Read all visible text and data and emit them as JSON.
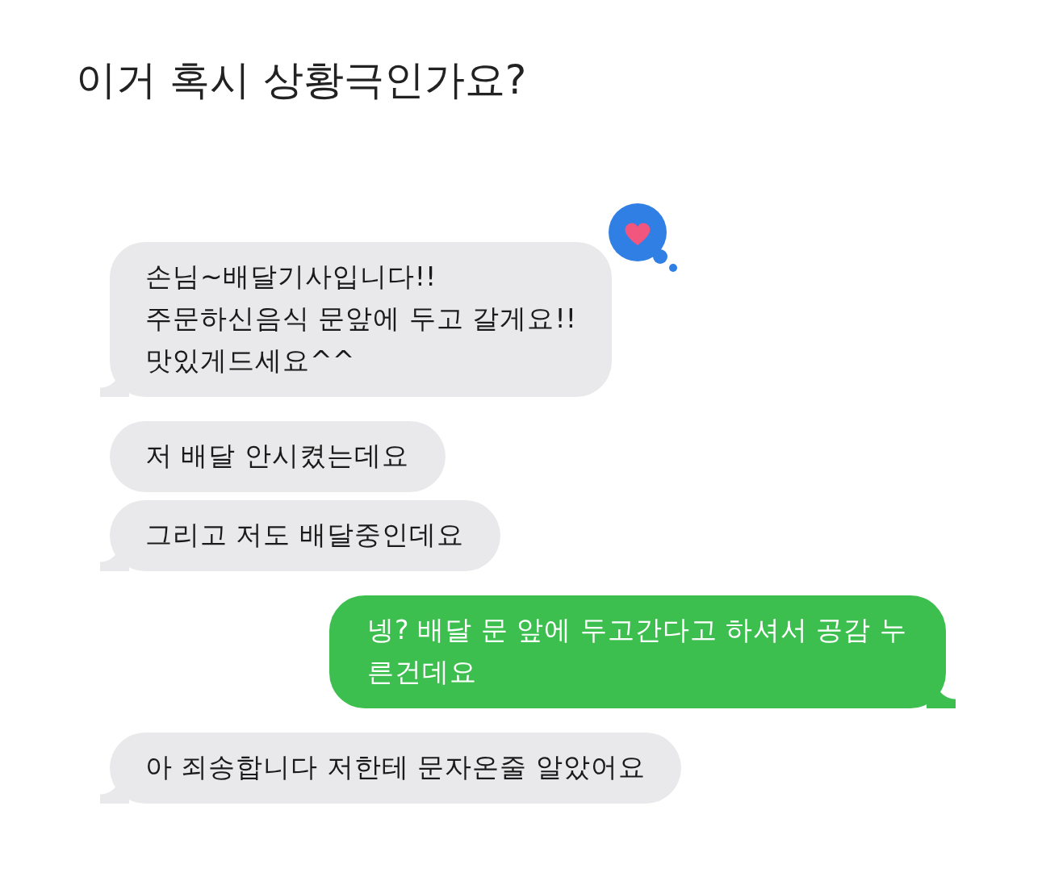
{
  "title": "이거 혹시 상황극인가요?",
  "messages": [
    {
      "kind": "received",
      "text": "손님~배달기사입니다!!\n주문하신음식 문앞에 두고 갈게요!!\n맛있게드세요^^",
      "tail": true,
      "hearted": true
    },
    {
      "kind": "received",
      "text": "저 배달 안시켰는데요",
      "tail": false
    },
    {
      "kind": "received",
      "text": "그리고 저도 배달중인데요",
      "tail": true
    },
    {
      "kind": "sent",
      "text": "넹? 배달 문 앞에 두고간다고 하셔서 공감 누\n른건데요",
      "tail": true
    },
    {
      "kind": "received",
      "text": "아 죄송합니다 저한테 문자온줄 알았어요",
      "tail": true
    }
  ]
}
